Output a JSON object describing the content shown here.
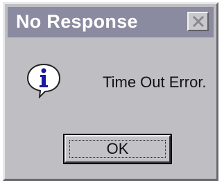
{
  "dialog": {
    "title": "No Response",
    "close_icon": "close-icon",
    "icon": "info-icon",
    "message": "Time Out Error.",
    "ok_label": "OK"
  },
  "colors": {
    "titlebar": "#8a8aa0",
    "body": "#bfbfc3",
    "icon_blue": "#1a1aa0"
  }
}
